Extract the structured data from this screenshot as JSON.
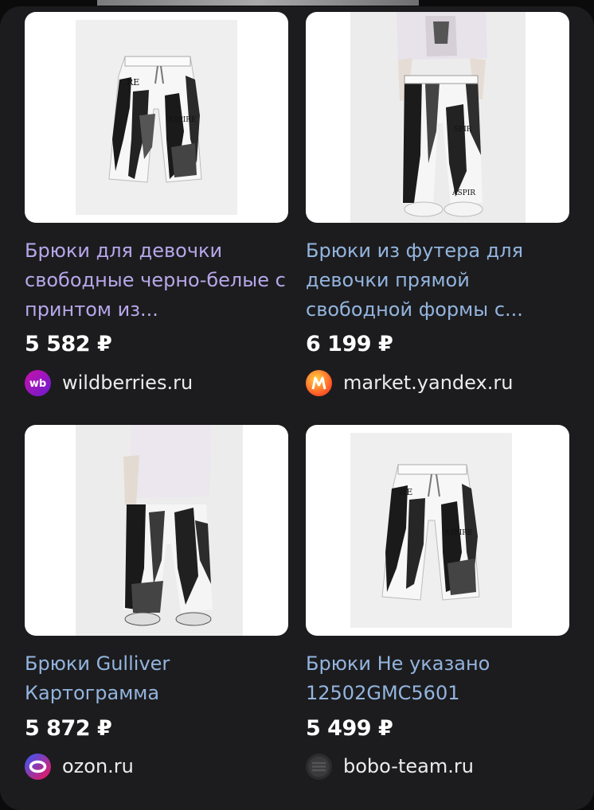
{
  "colors": {
    "title_visited": "#b7a7ea",
    "title_link": "#93b4de",
    "price": "#ffffff",
    "background": "#1c1c1e"
  },
  "products": [
    {
      "title": "Брюки для девочки свободные черно-белые с принтом из...",
      "price": "5 582 ₽",
      "source": "wildberries.ru",
      "logo_icon": "wildberries-logo-icon",
      "photo_icon": "wide-printed-trousers-photo"
    },
    {
      "title": "Брюки из футера для девочки прямой свободной формы с...",
      "price": "6 199 ₽",
      "source": "market.yandex.ru",
      "logo_icon": "yandex-market-logo-icon",
      "photo_icon": "model-wearing-trousers-photo"
    },
    {
      "title": "Брюки Gulliver Картограмма",
      "price": "5 872 ₽",
      "source": "ozon.ru",
      "logo_icon": "ozon-logo-icon",
      "photo_icon": "model-wearing-trousers-photo"
    },
    {
      "title": "Брюки Не указано 12502GMC5601",
      "price": "5 499 ₽",
      "source": "bobo-team.ru",
      "logo_icon": "bobo-team-logo-icon",
      "photo_icon": "wide-printed-trousers-photo"
    }
  ]
}
